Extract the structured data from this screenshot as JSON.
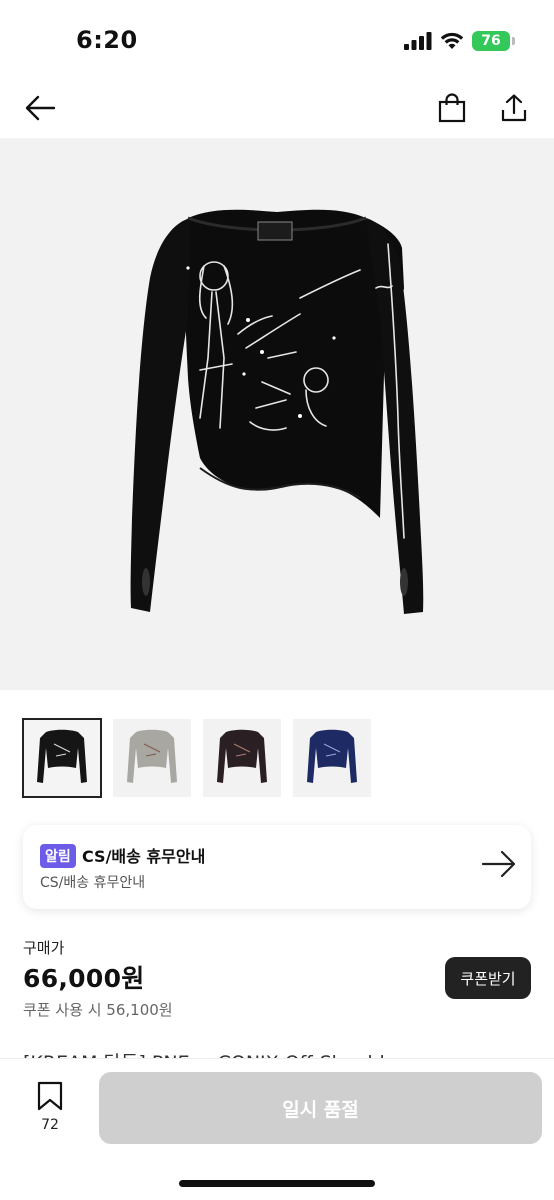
{
  "status": {
    "time": "6:20",
    "battery": "76"
  },
  "nav": {
    "back_icon": "arrow-left-icon",
    "bag_icon": "shopping-bag-icon",
    "share_icon": "share-icon"
  },
  "product_image": {
    "variant": "black"
  },
  "thumbnails": [
    {
      "color": "#151515",
      "selected": true
    },
    {
      "color": "#a9a7a2",
      "selected": false
    },
    {
      "color": "#2a1f22",
      "selected": false
    },
    {
      "color": "#1d2a63",
      "selected": false
    }
  ],
  "notice": {
    "badge": "알림",
    "title": "CS/배송 휴무안내",
    "subtitle": "CS/배송 휴무안내"
  },
  "price": {
    "label": "구매가",
    "value": "66,000원",
    "coupon_text": "쿠폰 사용 시 56,100원",
    "coupon_button": "쿠폰받기"
  },
  "product_title_peek": "[KREAM 단독] PNE × CONIX Off-Shoulder",
  "bottom": {
    "bookmark_count": "72",
    "soldout_label": "일시 품절"
  },
  "colors": {
    "accent": "#6c5ce7",
    "dark_button": "#222222",
    "disabled": "#cfcfcf",
    "battery": "#34c759"
  }
}
